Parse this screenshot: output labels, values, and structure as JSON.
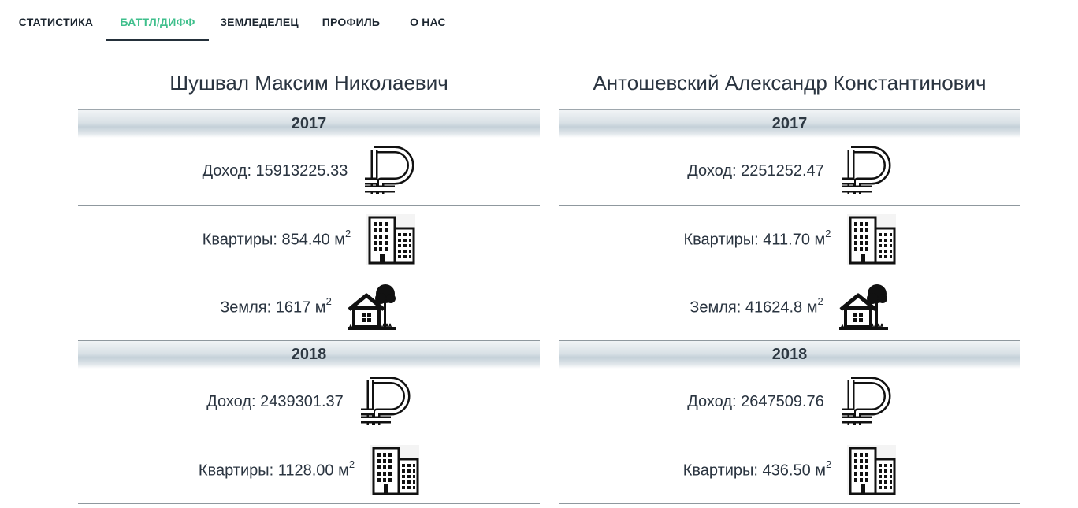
{
  "nav": {
    "items": [
      {
        "label": "СТАТИСТИКА",
        "active": false
      },
      {
        "label": "БАТТЛ/ДИФФ",
        "active": true
      },
      {
        "label": "ЗЕМЛЕДЕЛЕЦ",
        "active": false
      },
      {
        "label": "ПРОФИЛЬ",
        "active": false
      },
      {
        "label": "О НАС",
        "active": false
      }
    ],
    "active_color": "#3fbf8c"
  },
  "unit_sup": "2",
  "people": [
    {
      "name": "Шушвал Максим Николаевич",
      "years": [
        {
          "year": "2017",
          "income_label": "Доход: 15913225.33",
          "flats_label": "Квартиры: 854.40 м",
          "land_label": "Земля: 1617 м"
        },
        {
          "year": "2018",
          "income_label": "Доход: 2439301.37",
          "flats_label": "Квартиры: 1128.00 м"
        }
      ]
    },
    {
      "name": "Антошевский Александр Константинович",
      "years": [
        {
          "year": "2017",
          "income_label": "Доход: 2251252.47",
          "flats_label": "Квартиры: 411.70 м",
          "land_label": "Земля: 41624.8 м"
        },
        {
          "year": "2018",
          "income_label": "Доход: 2647509.76",
          "flats_label": "Квартиры: 436.50 м"
        }
      ]
    }
  ],
  "icons": {
    "income": "ruble-icon",
    "flats": "apartment-building-icon",
    "land": "house-with-tree-icon"
  }
}
